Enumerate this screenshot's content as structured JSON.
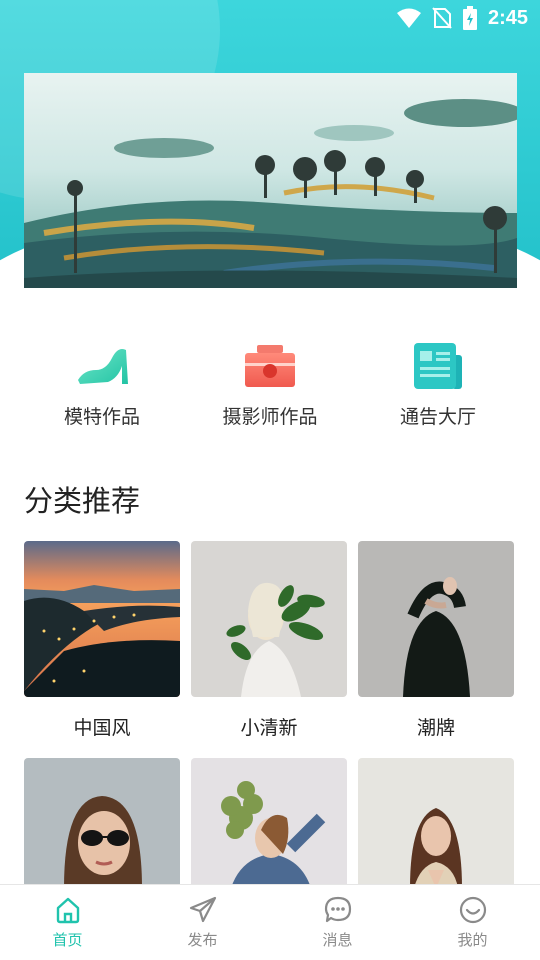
{
  "status_bar": {
    "time": "2:45"
  },
  "quick_entries": [
    {
      "label": "模特作品",
      "icon": "high-heel-icon"
    },
    {
      "label": "摄影师作品",
      "icon": "camera-icon"
    },
    {
      "label": "通告大厅",
      "icon": "notice-board-icon"
    }
  ],
  "section": {
    "title": "分类推荐"
  },
  "categories": [
    {
      "label": "中国风"
    },
    {
      "label": "小清新"
    },
    {
      "label": "潮牌"
    },
    {
      "label": ""
    },
    {
      "label": ""
    },
    {
      "label": ""
    }
  ],
  "bottom_nav": [
    {
      "label": "首页",
      "icon": "home-icon",
      "active": true
    },
    {
      "label": "发布",
      "icon": "paper-plane-icon",
      "active": false
    },
    {
      "label": "消息",
      "icon": "chat-bubble-icon",
      "active": false
    },
    {
      "label": "我的",
      "icon": "smile-icon",
      "active": false
    }
  ],
  "colors": {
    "header": "#24c2cb",
    "accent": "#20c3ad",
    "camera": "#f05a4f",
    "muted": "#8a8a8a"
  }
}
